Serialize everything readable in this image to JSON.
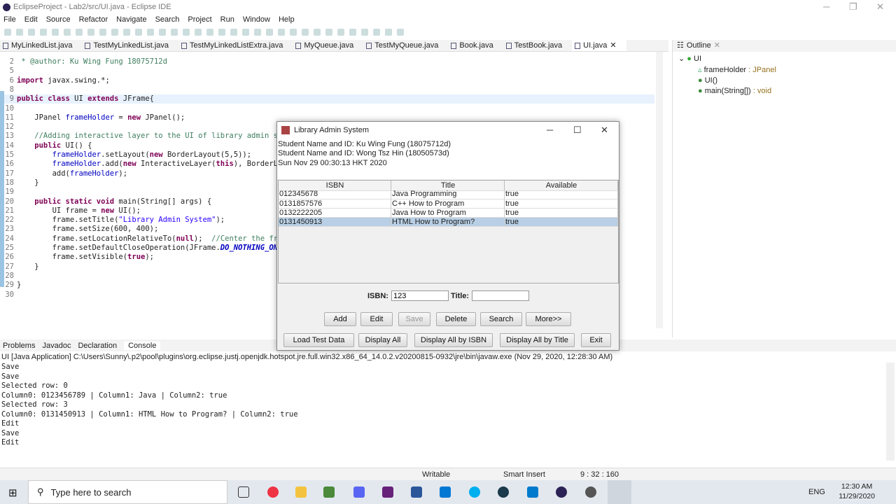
{
  "window": {
    "title": "EclipseProject - Lab2/src/UI.java - Eclipse IDE"
  },
  "menu": [
    "File",
    "Edit",
    "Source",
    "Refactor",
    "Navigate",
    "Search",
    "Project",
    "Run",
    "Window",
    "Help"
  ],
  "editor_tabs": [
    {
      "label": "MyLinkedList.java"
    },
    {
      "label": "TestMyLinkedList.java"
    },
    {
      "label": "TestMyLinkedListExtra.java"
    },
    {
      "label": "MyQueue.java"
    },
    {
      "label": "TestMyQueue.java"
    },
    {
      "label": "Book.java"
    },
    {
      "label": "TestBook.java"
    },
    {
      "label": "UI.java",
      "active": true
    }
  ],
  "code": [
    [
      "2",
      [
        [
          " * @author: Ku Wing Fung 18075712d",
          "cmt"
        ]
      ]
    ],
    [
      "5",
      []
    ],
    [
      "6",
      [
        [
          "import",
          "kw"
        ],
        [
          " javax.swing.*;",
          ""
        ]
      ]
    ],
    [
      "8",
      []
    ],
    [
      "9",
      [
        [
          "public class",
          "kw"
        ],
        [
          " UI ",
          ""
        ],
        [
          "extends",
          "kw"
        ],
        [
          " JFrame{",
          ""
        ]
      ]
    ],
    [
      "10",
      []
    ],
    [
      "11",
      [
        [
          "    JPanel ",
          ""
        ],
        [
          "frameHolder",
          "fld"
        ],
        [
          " = ",
          ""
        ],
        [
          "new",
          "kw"
        ],
        [
          " JPanel();",
          ""
        ]
      ]
    ],
    [
      "12",
      []
    ],
    [
      "13",
      [
        [
          "    //Adding interactive layer to the UI of library admin sys",
          "cmt"
        ]
      ]
    ],
    [
      "14",
      [
        [
          "    public",
          "kw"
        ],
        [
          " UI() {",
          ""
        ]
      ]
    ],
    [
      "15",
      [
        [
          "        frameHolder",
          "fld"
        ],
        [
          ".setLayout(",
          ""
        ],
        [
          "new",
          "kw"
        ],
        [
          " BorderLayout(5,5));",
          ""
        ]
      ]
    ],
    [
      "16",
      [
        [
          "        frameHolder",
          "fld"
        ],
        [
          ".add(",
          ""
        ],
        [
          "new",
          "kw"
        ],
        [
          " InteractiveLayer(",
          ""
        ],
        [
          "this",
          "kw"
        ],
        [
          "), BorderLay",
          ""
        ]
      ]
    ],
    [
      "17",
      [
        [
          "        add(",
          ""
        ],
        [
          "frameHolder",
          "fld"
        ],
        [
          ");",
          ""
        ]
      ]
    ],
    [
      "18",
      [
        [
          "    }",
          ""
        ]
      ]
    ],
    [
      "19",
      []
    ],
    [
      "20",
      [
        [
          "    public static void",
          "kw"
        ],
        [
          " main(String[] args) {",
          ""
        ]
      ]
    ],
    [
      "21",
      [
        [
          "        UI frame = ",
          ""
        ],
        [
          "new",
          "kw"
        ],
        [
          " UI();",
          ""
        ]
      ]
    ],
    [
      "22",
      [
        [
          "        frame.setTitle(",
          ""
        ],
        [
          "\"Library Admin System\"",
          "str"
        ],
        [
          ");",
          ""
        ]
      ]
    ],
    [
      "23",
      [
        [
          "        frame.setSize(600, 400);",
          ""
        ]
      ]
    ],
    [
      "24",
      [
        [
          "        frame.setLocationRelativeTo(",
          ""
        ],
        [
          "null",
          "kw"
        ],
        [
          ");  ",
          ""
        ],
        [
          "//Center the fram",
          "cmt"
        ]
      ]
    ],
    [
      "25",
      [
        [
          "        frame.setDefaultCloseOperation(JFrame.",
          ""
        ],
        [
          "DO_NOTHING_ON_C",
          "st"
        ]
      ]
    ],
    [
      "26",
      [
        [
          "        frame.setVisible(",
          ""
        ],
        [
          "true",
          "kw"
        ],
        [
          ");",
          ""
        ]
      ]
    ],
    [
      "27",
      [
        [
          "    }",
          ""
        ]
      ]
    ],
    [
      "28",
      []
    ],
    [
      "29",
      [
        [
          "}",
          ""
        ]
      ]
    ],
    [
      "30",
      []
    ]
  ],
  "outline": {
    "title": "Outline",
    "root": "UI",
    "items": [
      {
        "name": "frameHolder",
        "type": " : JPanel"
      },
      {
        "name": "UI()",
        "type": ""
      },
      {
        "name": "main(String[])",
        "type": " : void"
      }
    ]
  },
  "bottom_tabs": [
    "Problems",
    "Javadoc",
    "Declaration",
    "Console"
  ],
  "console": {
    "header": "UI [Java Application] C:\\Users\\Sunny\\.p2\\pool\\plugins\\org.eclipse.justj.openjdk.hotspot.jre.full.win32.x86_64_14.0.2.v20200815-0932\\jre\\bin\\javaw.exe  (Nov 29, 2020, 12:28:30 AM)",
    "lines": [
      "Save",
      "Save",
      "Selected row: 0",
      "Column0: 0123456789 | Column1: Java | Column2: true",
      "Selected row: 3",
      "Column0: 0131450913 | Column1: HTML How to Program? | Column2: true",
      "Edit",
      "Save",
      "Edit"
    ]
  },
  "status": {
    "mode": "Writable",
    "insert": "Smart Insert",
    "position": "9 : 32 : 160"
  },
  "taskbar": {
    "search_placeholder": "Type here to search",
    "time": "12:30 AM",
    "date": "11/29/2020",
    "lang": "ENG"
  },
  "dialog": {
    "title": "Library Admin System",
    "info": [
      "Student Name and ID: Ku Wing Fung (18075712d)",
      "Student Name and ID: Wong Tsz Hin (18050573d)",
      "Sun Nov 29 00:30:13 HKT 2020"
    ],
    "columns": [
      "ISBN",
      "Title",
      "Available"
    ],
    "rows": [
      [
        "012345678",
        "Java Programming",
        "true"
      ],
      [
        "0131857576",
        "C++ How to Program",
        "true"
      ],
      [
        "0132222205",
        "Java How to Program",
        "true"
      ],
      [
        "0131450913",
        "HTML How to Program?",
        "true"
      ]
    ],
    "selected_row": 3,
    "isbn_label": "ISBN:",
    "isbn_value": "123",
    "title_label": "Title:",
    "title_value": "",
    "buttons1": [
      "Add",
      "Edit",
      "Save",
      "Delete",
      "Search",
      "More>>"
    ],
    "buttons2": [
      "Load Test Data",
      "Display All",
      "Display All by ISBN",
      "Display All by Title",
      "Exit"
    ]
  }
}
